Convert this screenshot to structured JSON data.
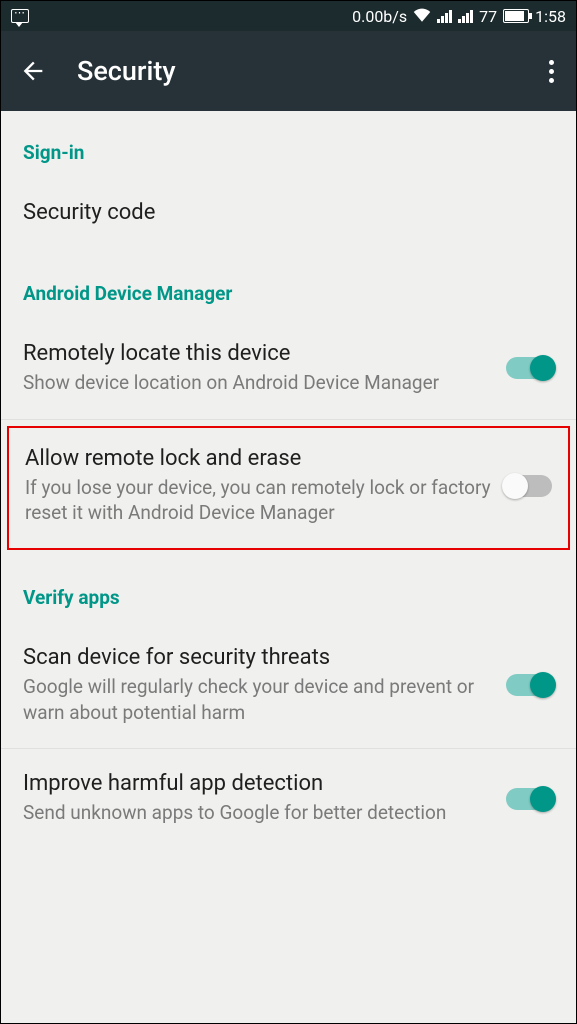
{
  "status_bar": {
    "data_rate": "0.00b/s",
    "battery_pct": "77",
    "time": "1:58"
  },
  "app_bar": {
    "title": "Security"
  },
  "sections": {
    "signin": {
      "title": "Sign-in",
      "securityCode": "Security code"
    },
    "adm": {
      "title": "Android Device Manager",
      "locate": {
        "title": "Remotely locate this device",
        "sub": "Show device location on Android Device Manager"
      },
      "lockErase": {
        "title": "Allow remote lock and erase",
        "sub": "If you lose your device, you can remotely lock or factory reset it with Android Device Manager"
      }
    },
    "verify": {
      "title": "Verify apps",
      "scan": {
        "title": "Scan device for security threats",
        "sub": "Google will regularly check your device and prevent or warn about potential harm"
      },
      "improve": {
        "title": "Improve harmful app detection",
        "sub": "Send unknown apps to Google for better detection"
      }
    }
  }
}
